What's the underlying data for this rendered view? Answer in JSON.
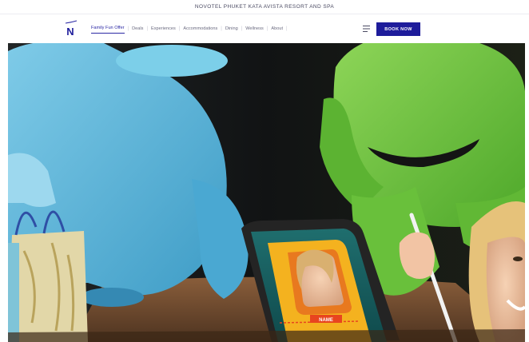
{
  "banner": {
    "hotel_name": "NOVOTEL PHUKET KATA AVISTA RESORT AND SPA"
  },
  "logo": {
    "letter": "N"
  },
  "nav": {
    "items": [
      {
        "label": "Family Fun Offer",
        "active": true
      },
      {
        "label": "Deals",
        "active": false
      },
      {
        "label": "Experiences",
        "active": false
      },
      {
        "label": "Accommodations",
        "active": false
      },
      {
        "label": "Dining",
        "active": false
      },
      {
        "label": "Wellness",
        "active": false
      },
      {
        "label": "About",
        "active": false
      }
    ],
    "separator": "|"
  },
  "header": {
    "book_label": "BOOK NOW"
  },
  "tablet": {
    "name_label": "NAME"
  },
  "colors": {
    "brand": "#1e1c9b",
    "blue_mascot": "#5bb7dc",
    "green_mascot": "#6bc03c",
    "tablet_frame": "#f4b21f"
  },
  "icons": {
    "menu": "hamburger-icon",
    "logo": "novotel-logo-icon"
  }
}
